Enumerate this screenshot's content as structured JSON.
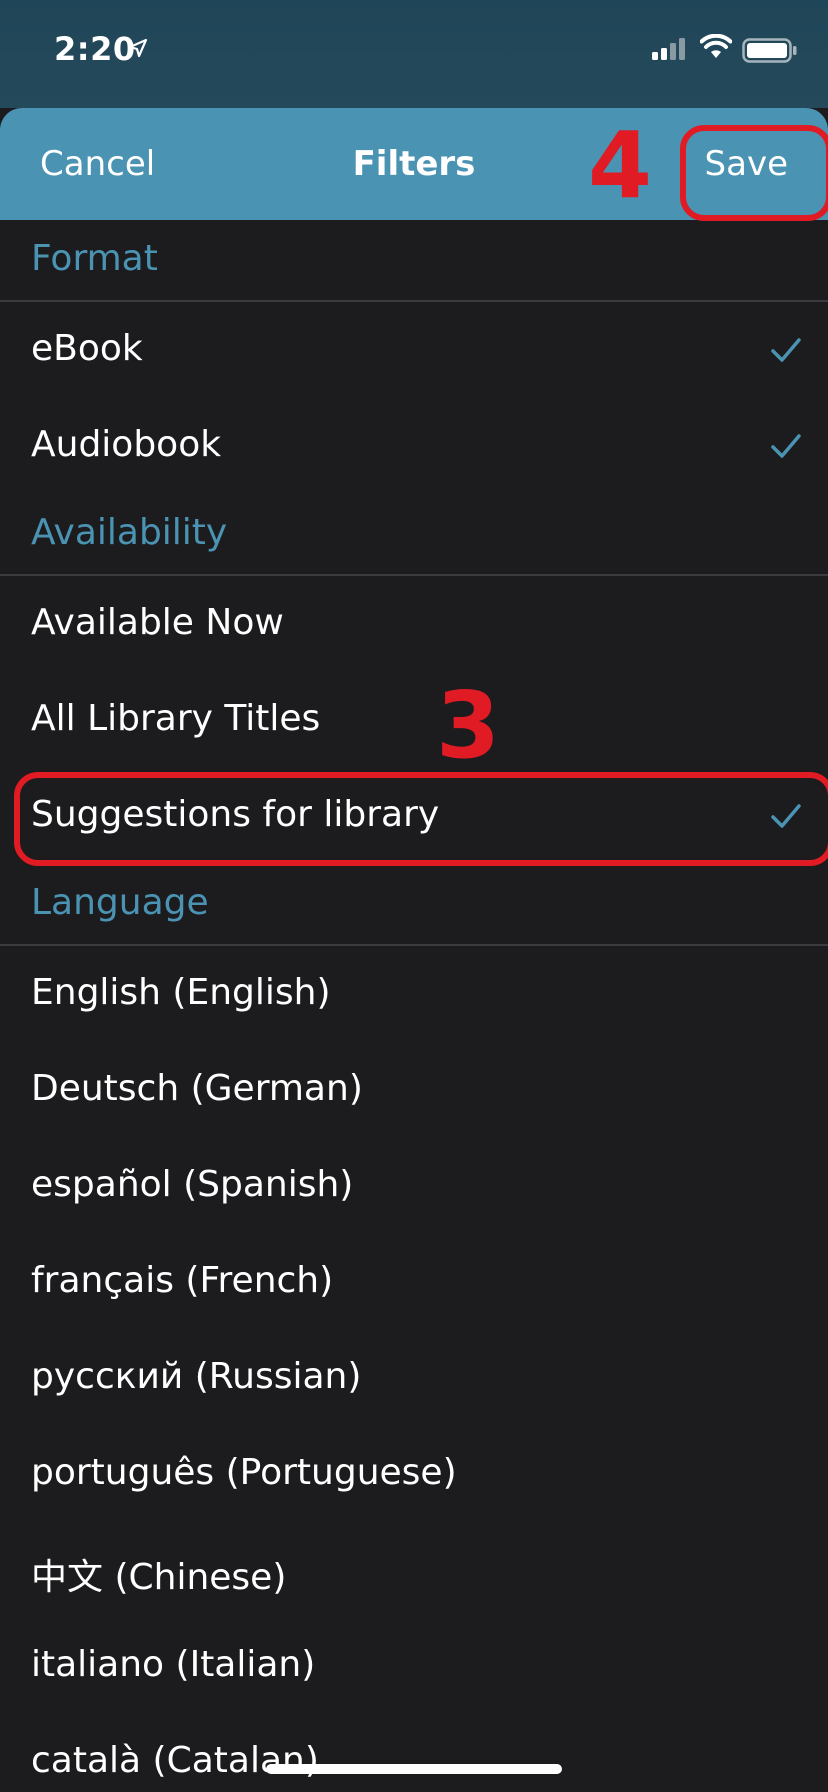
{
  "status_bar": {
    "time": "2:20"
  },
  "nav": {
    "cancel_label": "Cancel",
    "title": "Filters",
    "save_label": "Save"
  },
  "sections": [
    {
      "title": "Format",
      "items": [
        {
          "label": "eBook",
          "checked": true
        },
        {
          "label": "Audiobook",
          "checked": true
        }
      ]
    },
    {
      "title": "Availability",
      "items": [
        {
          "label": "Available Now",
          "checked": false
        },
        {
          "label": "All Library Titles",
          "checked": false
        },
        {
          "label": "Suggestions for library",
          "checked": true
        }
      ]
    },
    {
      "title": "Language",
      "items": [
        {
          "label": "English (English)",
          "checked": false
        },
        {
          "label": "Deutsch (German)",
          "checked": false
        },
        {
          "label": "español (Spanish)",
          "checked": false
        },
        {
          "label": "français (French)",
          "checked": false
        },
        {
          "label": "русский (Russian)",
          "checked": false
        },
        {
          "label": "português (Portuguese)",
          "checked": false
        },
        {
          "label": "中文 (Chinese)",
          "checked": false
        },
        {
          "label": "italiano (Italian)",
          "checked": false
        },
        {
          "label": "català (Catalan)",
          "checked": false
        }
      ]
    }
  ],
  "annotations": {
    "step_save": "4",
    "step_suggestions": "3",
    "color": "#e01b24"
  },
  "colors": {
    "accent": "#4a93b3",
    "background": "#1c1c1e",
    "checkmark": "#4a93b3"
  }
}
